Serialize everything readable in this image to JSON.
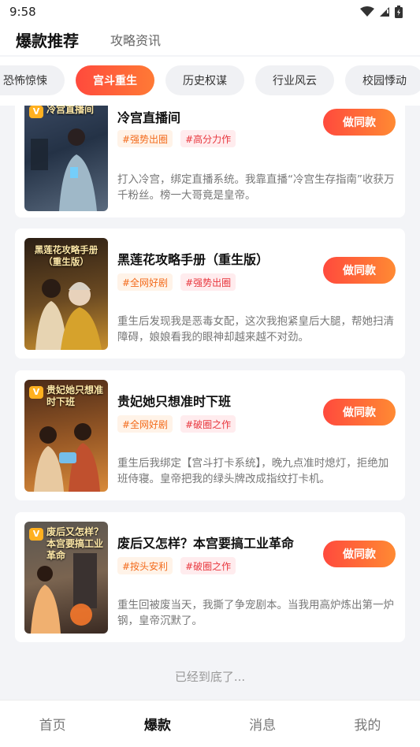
{
  "status_bar": {
    "time": "9:58"
  },
  "header": {
    "tabs": [
      {
        "label": "爆款推荐"
      },
      {
        "label": "攻略资讯"
      }
    ]
  },
  "categories": [
    {
      "label": "恐怖惊悚"
    },
    {
      "label": "宫斗重生"
    },
    {
      "label": "历史权谋"
    },
    {
      "label": "行业风云"
    },
    {
      "label": "校园悸动"
    }
  ],
  "items": [
    {
      "title": "冷宫直播间",
      "cover_title": "冷宫直播间",
      "tags": [
        "#强势出圈",
        "#高分力作"
      ],
      "description": "打入冷宫，绑定直播系统。我靠直播“冷宫生存指南”收获万千粉丝。榜一大哥竟是皇帝。",
      "button": "做同款"
    },
    {
      "title": "黑莲花攻略手册（重生版）",
      "cover_title": "黑莲花攻略手册（重生版）",
      "tags": [
        "#全网好剧",
        "#强势出圈"
      ],
      "description": "重生后发现我是恶毒女配，这次我抱紧皇后大腿，帮她扫清障碍，娘娘看我的眼神却越来越不对劲。",
      "button": "做同款"
    },
    {
      "title": "贵妃她只想准时下班",
      "cover_title": "贵妃她只想准时下班",
      "tags": [
        "#全网好剧",
        "#破圈之作"
      ],
      "description": "重生后我绑定【宫斗打卡系统】，晚九点准时熄灯，拒绝加班侍寝。皇帝把我的绿头牌改成指纹打卡机。",
      "button": "做同款"
    },
    {
      "title": "废后又怎样？本宫要搞工业革命",
      "cover_title": "废后又怎样？本宫要搞工业革命",
      "tags": [
        "#按头安利",
        "#破圈之作"
      ],
      "description": "重生回被废当天，我撕了争宠剧本。当我用高炉炼出第一炉钢，皇帝沉默了。",
      "button": "做同款"
    }
  ],
  "end_text": "已经到底了...",
  "bottom_nav": [
    {
      "label": "首页"
    },
    {
      "label": "爆款"
    },
    {
      "label": "消息"
    },
    {
      "label": "我的"
    }
  ],
  "colors": {
    "accent": "#ff4a3d",
    "accent_end": "#ff8a33",
    "background": "#f3f4f7"
  }
}
